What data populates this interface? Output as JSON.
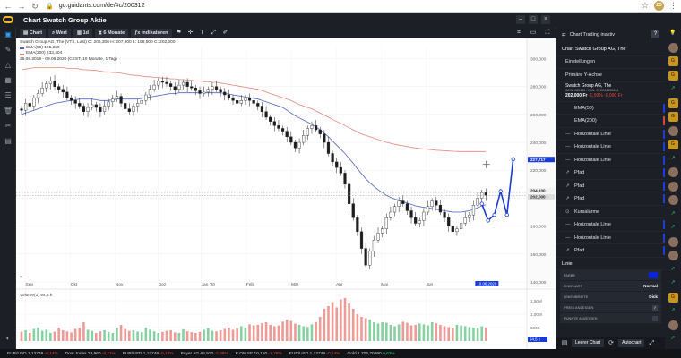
{
  "browser": {
    "url": "go.guidants.com/de/#c/200312",
    "avatar_initials": "ZD"
  },
  "app": {
    "title": "Chart Swatch Group Aktie",
    "brand_color": "#f4b728"
  },
  "left_sidebar": {
    "items": [
      "dashboard-icon",
      "pencil-icon",
      "warning-icon",
      "grid-icon",
      "list-icon",
      "trash-icon",
      "tools-icon",
      "document-icon",
      "contrast-icon"
    ]
  },
  "toolbar": {
    "chart_label": "Chart",
    "wert_label": "Wert",
    "interval_label": "1d",
    "period_label": "6 Monate",
    "indicators_label": "Indikatoren"
  },
  "chart": {
    "legend_title": "Swatch Group AG, The (VTX, Last) O: 206,300  H: 207,300  L: 198,500  C: 202,000",
    "legend_ema50": "EMA(50) 195,260",
    "legend_ema200": "EMA(200) 233,404",
    "legend_meta": "26.08.2019 - 09.06.2020   (CEST, 10 Monate, 1 Tag)",
    "volume_label": "Volume(1) 94,5 k",
    "volume_value": "94,5 k",
    "cursor_date_label": "10.06.2020",
    "price_tag_current": "227,717",
    "price_tag_a": "204,100",
    "price_tag_b": "202,000",
    "price_tag_vol": "94,5 k"
  },
  "chart_data": {
    "type": "candlestick",
    "x_labels": [
      "Sep",
      "Okt",
      "Nov",
      "Dez",
      "Jan '20",
      "Feb",
      "Mär",
      "Apr",
      "Mai",
      "Jun"
    ],
    "y_ticks": [
      "140,000",
      "160,000",
      "180,000",
      "200,000",
      "220,000",
      "240,000",
      "260,000",
      "280,000",
      "300,000"
    ],
    "ylim": [
      140,
      308
    ],
    "volume_ticks": [
      "500K",
      "1,00M",
      "1,50M"
    ],
    "volume_ylim": [
      0,
      1800000
    ],
    "close": [
      263,
      268,
      266,
      272,
      275,
      279,
      282,
      284,
      280,
      278,
      276,
      272,
      270,
      268,
      266,
      262,
      265,
      267,
      265,
      262,
      266,
      269,
      271,
      273,
      268,
      264,
      262,
      266,
      268,
      270,
      274,
      278,
      281,
      284,
      283,
      282,
      280,
      278,
      281,
      283,
      280,
      279,
      277,
      275,
      276,
      278,
      280,
      278,
      276,
      274,
      272,
      270,
      268,
      270,
      272,
      270,
      268,
      266,
      262,
      258,
      255,
      252,
      250,
      248,
      244,
      240,
      236,
      240,
      245,
      250,
      252,
      249,
      246,
      240,
      232,
      226,
      222,
      218,
      210,
      196,
      186,
      176,
      164,
      152,
      162,
      170,
      175,
      178,
      186,
      190,
      194,
      198,
      196,
      191,
      186,
      182,
      184,
      190,
      194,
      198,
      195,
      190,
      186,
      180,
      176,
      178,
      182,
      186,
      188,
      195,
      200,
      204,
      202
    ],
    "ema50": [
      260,
      261,
      262,
      263,
      264,
      265,
      266,
      267,
      268,
      268.5,
      269,
      269.5,
      270,
      270.5,
      271,
      271,
      271,
      271,
      270.5,
      270,
      270,
      270,
      270.5,
      271,
      271,
      271,
      271,
      271,
      271,
      271.5,
      272,
      272.5,
      273,
      273.5,
      274,
      274.5,
      275,
      275,
      275.5,
      275.5,
      275.5,
      275.5,
      275.5,
      275.5,
      275.5,
      275.5,
      275.5,
      275.5,
      275.5,
      275,
      274.5,
      274,
      273.5,
      273,
      272.5,
      272,
      271.5,
      271,
      270,
      269,
      268,
      267,
      266,
      265,
      263,
      261,
      259,
      257.5,
      256,
      254.5,
      253,
      251,
      249,
      246.5,
      244,
      241,
      238,
      235,
      232,
      228.5,
      225,
      221,
      217.5,
      214,
      211,
      208.5,
      206,
      204,
      202,
      200.5,
      199.5,
      198.5,
      197.5,
      196.5,
      195.5,
      194.5,
      194,
      193.5,
      193,
      192.5,
      192,
      191.5,
      191,
      190.5,
      190,
      190,
      190,
      190.5,
      191,
      192,
      193,
      194.5,
      195.3
    ],
    "ema200": [
      292,
      292.5,
      293,
      293.5,
      293.5,
      293.5,
      293.5,
      293.5,
      293.5,
      293.5,
      293.5,
      293,
      293,
      293,
      292.5,
      292,
      292,
      291.5,
      291.5,
      291,
      290.5,
      290.5,
      290,
      290,
      289.5,
      289,
      288.5,
      288,
      288,
      287.5,
      287,
      287,
      286.5,
      286.5,
      286,
      286,
      285.5,
      285.5,
      285,
      285,
      284.5,
      284.5,
      284,
      284,
      283.5,
      283.5,
      283,
      283,
      282.5,
      282,
      281.5,
      281,
      280.5,
      280,
      279.5,
      279,
      278.5,
      278,
      277,
      276,
      275,
      274,
      273,
      272,
      271,
      270,
      268.5,
      267,
      266,
      265,
      264,
      262.5,
      261,
      259.5,
      258,
      256.5,
      255,
      253.5,
      252,
      250.5,
      249,
      247.5,
      246,
      245,
      244,
      243,
      242,
      241,
      240,
      239.3,
      238.6,
      238,
      237.5,
      237,
      236.5,
      236,
      235.6,
      235.3,
      235,
      234.7,
      234.4,
      234.2,
      234,
      233.8,
      233.6,
      233.5,
      233.4,
      233.4,
      233.4,
      233.4,
      233.4,
      233.4,
      233.4
    ],
    "drawing_path": [
      [
        203,
        196
      ],
      [
        204,
        184
      ],
      [
        205,
        188
      ],
      [
        206,
        205
      ],
      [
        207,
        188
      ],
      [
        208,
        228
      ]
    ],
    "horizontal_lines": [
      204.1,
      202.0
    ],
    "volume": [
      0.35,
      0.4,
      0.3,
      0.45,
      0.5,
      0.38,
      0.42,
      0.3,
      0.35,
      0.5,
      0.4,
      0.36,
      0.32,
      0.45,
      0.5,
      0.7,
      0.42,
      0.38,
      0.3,
      0.36,
      0.4,
      0.34,
      0.3,
      0.5,
      0.6,
      0.45,
      0.38,
      0.4,
      0.35,
      0.33,
      0.5,
      0.42,
      0.36,
      0.3,
      0.34,
      0.38,
      0.4,
      0.32,
      0.3,
      0.44,
      0.36,
      0.33,
      0.3,
      0.34,
      0.42,
      0.48,
      0.38,
      0.36,
      0.4,
      0.45,
      0.5,
      0.42,
      0.48,
      0.55,
      0.5,
      0.62,
      0.58,
      0.6,
      0.66,
      0.7,
      0.6,
      0.55,
      0.58,
      0.72,
      0.8,
      0.75,
      0.65,
      0.6,
      0.55,
      0.52,
      0.62,
      0.7,
      0.9,
      1.2,
      1.3,
      1.45,
      1.25,
      1.55,
      1.6,
      1.4,
      1.2,
      1.0,
      0.9,
      0.85,
      0.8,
      0.7,
      0.65,
      0.7,
      0.68,
      0.6,
      0.55,
      0.62,
      0.72,
      0.68,
      0.58,
      0.6,
      0.65,
      0.62,
      0.58,
      0.7,
      0.66,
      0.6,
      0.55,
      0.52,
      0.5,
      0.6,
      0.58,
      0.55,
      0.52,
      0.5,
      0.48,
      0.55,
      0.5
    ]
  },
  "right_panel": {
    "header": "Chart Trading inaktiv",
    "help": "?",
    "instrument_row": "Chart Swatch Group AG, The",
    "einstellungen": "Einstellungen",
    "primaere_y_achse": "Primäre Y-Achse",
    "instrument_name": "Swatch Group AG, The",
    "instrument_ids": "WKN: 865126 / ISIN: CH0012255151",
    "instrument_price": "202,000 Fr",
    "instrument_change": "-1,99%   -0,090 Fr",
    "rows": [
      {
        "icon": "",
        "label": "EMA(50)",
        "marker": "#1b3fd6"
      },
      {
        "icon": "",
        "label": "EMA(200)",
        "marker": "#d64a3a"
      },
      {
        "icon": "—",
        "label": "Horizontale Linie",
        "marker": "#1b3fd6"
      },
      {
        "icon": "—",
        "label": "Horizontale Linie",
        "marker": "#1b3fd6"
      },
      {
        "icon": "—",
        "label": "Horizontale Linie",
        "marker": "#1b3fd6"
      },
      {
        "icon": "↗",
        "label": "Pfad",
        "marker": "#1b3fd6"
      },
      {
        "icon": "↗",
        "label": "Pfad",
        "marker": "#1b3fd6"
      },
      {
        "icon": "↗",
        "label": "Pfad",
        "marker": "#1b3fd6"
      },
      {
        "icon": "⊙",
        "label": "Kursalarme",
        "marker": ""
      },
      {
        "icon": "—",
        "label": "Horizontale Linie",
        "marker": "#1b3fd6"
      },
      {
        "icon": "—",
        "label": "Horizontale Linie",
        "marker": "#1b3fd6"
      },
      {
        "icon": "↗",
        "label": "Pfad",
        "marker": "#1b3fd6"
      }
    ],
    "linie": "Linie",
    "farbe_label": "FARBE",
    "linienart_label": "LINIENART",
    "linienart_value": "Normal",
    "linienbreite_label": "LINIENBREITE",
    "linienbreite_value": "Dick",
    "preis_label": "PREIS ANZEIGEN",
    "punkte_label": "PUNKTE ANZEIGEN",
    "line_color": "#0b24d8",
    "leerer_chart": "Leerer Chart",
    "autochart": "Autochart"
  },
  "ticker": [
    {
      "name": "EUR/USD",
      "value": "1,12749",
      "change": "-0,14%"
    },
    {
      "name": "Dow Jones",
      "value": "23,960",
      "change": "-0,11%"
    },
    {
      "name": "EUR/USD",
      "value": "1,12749",
      "change": "-0,14%"
    },
    {
      "name": "Bayer AG",
      "value": "66,910",
      "change": "-2,35%"
    },
    {
      "name": "E.ON SE",
      "value": "10,150",
      "change": "-1,78%"
    },
    {
      "name": "EUR/USD",
      "value": "1,12749",
      "change": "-0,14%"
    },
    {
      "name": "Gold",
      "value": "1.706,70990",
      "change": "0,63%"
    }
  ]
}
